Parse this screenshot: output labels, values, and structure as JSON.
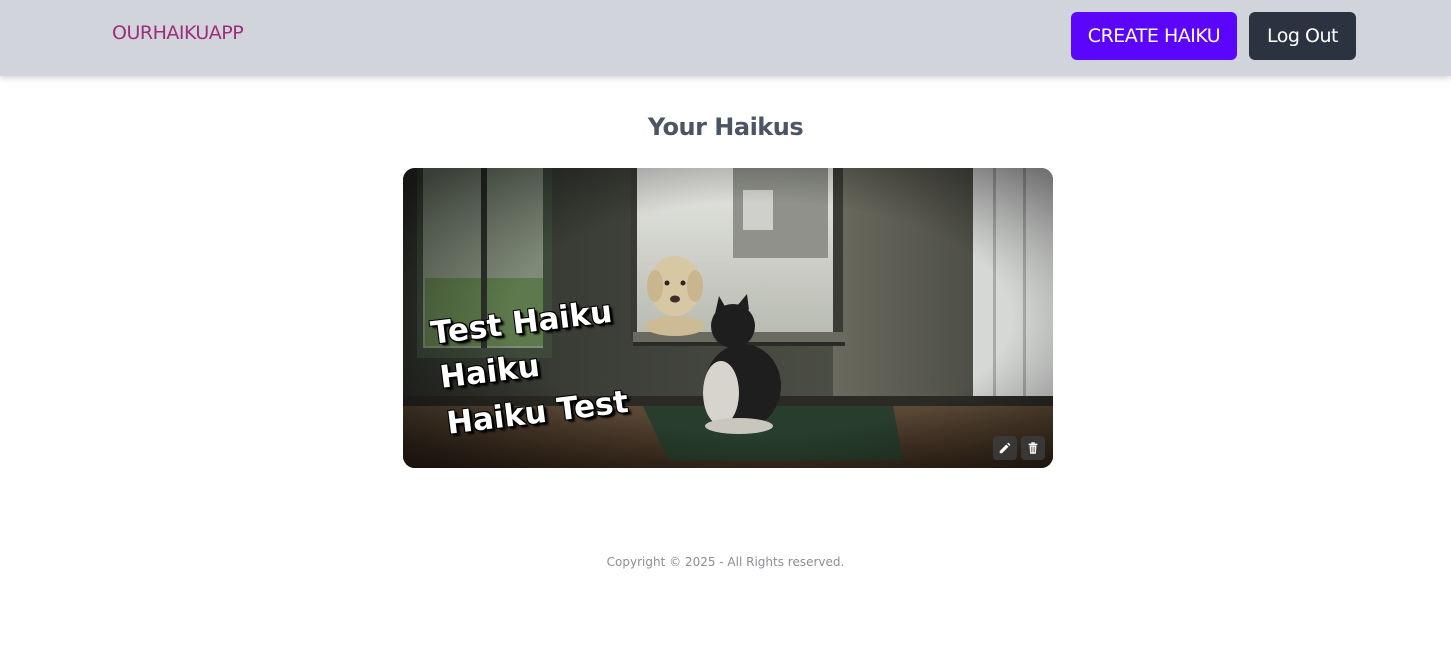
{
  "navbar": {
    "brand": "OURHAIKUAPP",
    "create_label": "CREATE HAIKU",
    "logout_label": "Log Out"
  },
  "main": {
    "title": "Your Haikus",
    "haikus": [
      {
        "lines": [
          "Test Haiku",
          "Haiku",
          "Haiku Test"
        ],
        "actions": {
          "edit_icon": "pencil-icon",
          "delete_icon": "trash-icon"
        }
      }
    ]
  },
  "footer": {
    "text": "Copyright © 2025 - All Rights reserved."
  },
  "colors": {
    "navbar_bg": "#d1d5db",
    "brand": "#9d2f79",
    "create_button": "#5b06fa",
    "logout_button": "#2b3340"
  }
}
